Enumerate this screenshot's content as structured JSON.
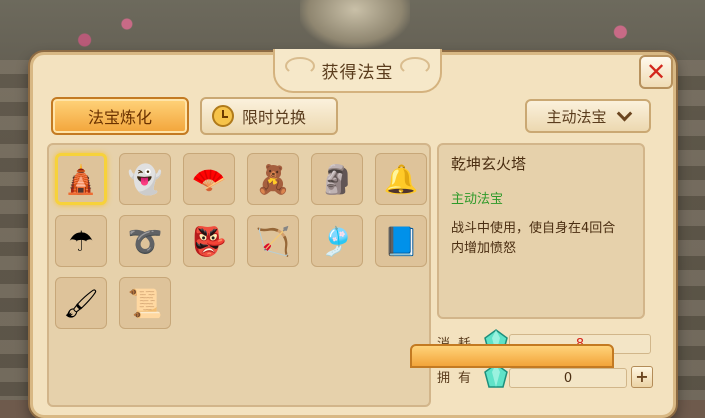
{
  "dialog": {
    "title": "获得法宝",
    "close_symbol": "✕"
  },
  "tabs": [
    {
      "label": "法宝炼化",
      "active": true
    },
    {
      "label": "限时兑换",
      "icon": "clock-icon",
      "active": false
    }
  ],
  "filter": {
    "selected": "主动法宝",
    "icon": "chevron-down-icon"
  },
  "items": [
    {
      "name": "golden-pagoda",
      "glyph": "🛕",
      "selected": true
    },
    {
      "name": "ghost-scroll",
      "glyph": "👻"
    },
    {
      "name": "fan-sword",
      "glyph": "🪭"
    },
    {
      "name": "voodoo-doll",
      "glyph": "🧸"
    },
    {
      "name": "seal-stamp",
      "glyph": "🗿"
    },
    {
      "name": "bell",
      "glyph": "🔔"
    },
    {
      "name": "umbrella",
      "glyph": "☂"
    },
    {
      "name": "rope",
      "glyph": "➰"
    },
    {
      "name": "mask-crown",
      "glyph": "👺"
    },
    {
      "name": "bow",
      "glyph": "🏹"
    },
    {
      "name": "gong-bell",
      "glyph": "🎐"
    },
    {
      "name": "book",
      "glyph": "📘"
    },
    {
      "name": "brush",
      "glyph": "🖌"
    },
    {
      "name": "painting-scroll",
      "glyph": "📜"
    }
  ],
  "detail": {
    "name": "乾坤玄火塔",
    "type": "主动法宝",
    "description": "战斗中使用，使自身在4回合内增加愤怒"
  },
  "cost": {
    "consume_label": "消耗",
    "consume_value": "8",
    "own_label": "拥有",
    "own_value": "0",
    "currency_icon": "gem-icon",
    "plus_symbol": "+"
  },
  "colors": {
    "panel": "#f3e2bf",
    "active_tab": "#f2a43a",
    "type_green": "#2f9a2a",
    "cost_red": "#d8261c"
  }
}
